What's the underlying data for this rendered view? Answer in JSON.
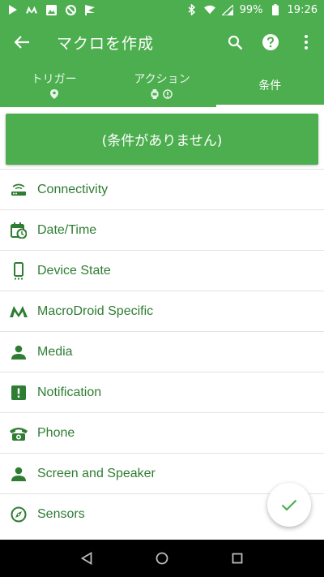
{
  "status_bar": {
    "battery": "99%",
    "time": "19:26"
  },
  "toolbar": {
    "title": "マクロを作成"
  },
  "tabs": [
    {
      "label": "トリガー"
    },
    {
      "label": "アクション"
    },
    {
      "label": "条件"
    }
  ],
  "banner": {
    "text": "(条件がありません)"
  },
  "categories": [
    {
      "label": "Connectivity",
      "icon": "router-icon"
    },
    {
      "label": "Date/Time",
      "icon": "calendar-clock-icon"
    },
    {
      "label": "Device State",
      "icon": "phone-device-icon"
    },
    {
      "label": "MacroDroid Specific",
      "icon": "macrodroid-logo-icon"
    },
    {
      "label": "Media",
      "icon": "person-icon"
    },
    {
      "label": "Notification",
      "icon": "notification-alert-icon"
    },
    {
      "label": "Phone",
      "icon": "telephone-icon"
    },
    {
      "label": "Screen and Speaker",
      "icon": "person-icon"
    },
    {
      "label": "Sensors",
      "icon": "compass-icon"
    }
  ],
  "colors": {
    "primary": "#4cae4f",
    "list_text": "#2e7d32",
    "icon": "#2e7d32"
  }
}
